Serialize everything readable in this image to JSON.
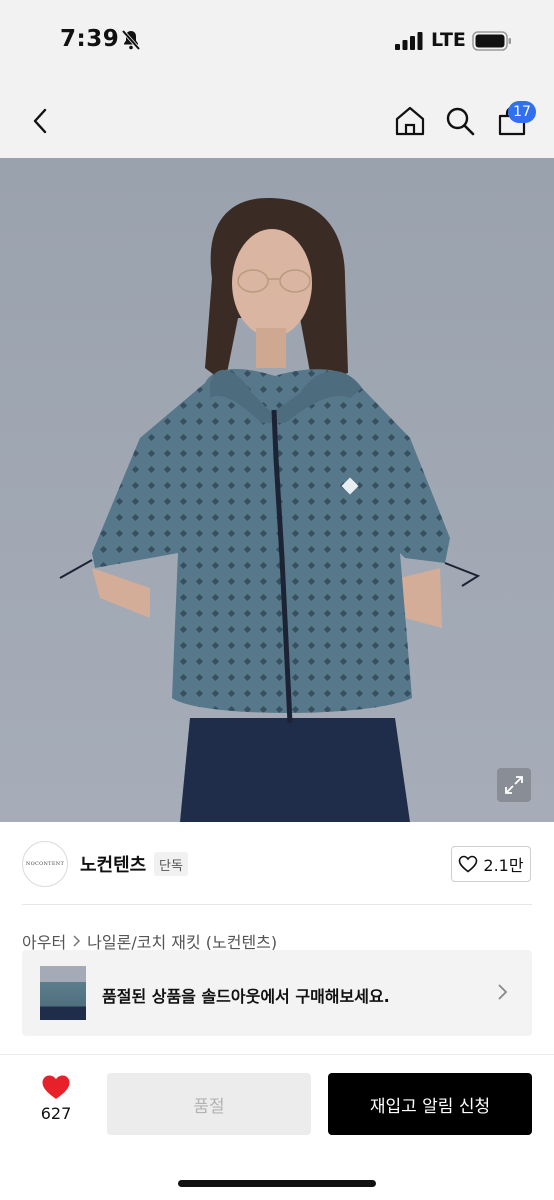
{
  "status_bar": {
    "time": "7:39",
    "network": "LTE"
  },
  "nav": {
    "cart_count": "17"
  },
  "brand": {
    "logo_text": "NOCONTENT",
    "name": "노컨텐츠",
    "tag": "단독",
    "likes": "2.1만"
  },
  "breadcrumb": {
    "category": "아우터",
    "subcategory": "나일론/코치 재킷 (노컨텐츠)"
  },
  "promo": {
    "text": "품절된 상품을 솔드아웃에서 구매해보세요."
  },
  "bottom_bar": {
    "like_count": "627",
    "soldout_label": "품절",
    "notify_label": "재입고 알림 신청"
  },
  "colors": {
    "badge": "#2f6ff0",
    "heart": "#e8202a",
    "primary_button": "#000000",
    "jacket": "#56788a"
  }
}
